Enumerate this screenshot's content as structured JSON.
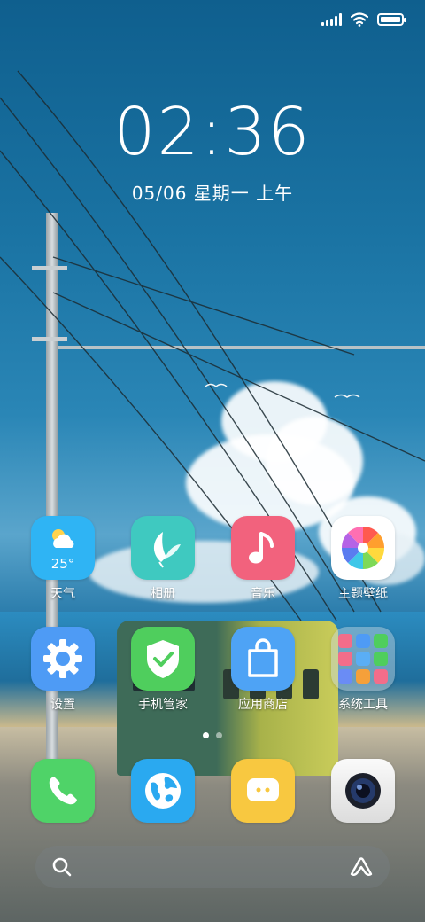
{
  "status_bar": {
    "signal": "signal-icon",
    "wifi": "wifi-icon",
    "battery": "battery-icon",
    "battery_level": 1.0
  },
  "lockscreen": {
    "time": "02:36",
    "date": "05/06 星期一 上午"
  },
  "apps_row1": [
    {
      "label": "天气",
      "icon": "weather-icon",
      "badge_text": "25°"
    },
    {
      "label": "相册",
      "icon": "gallery-icon"
    },
    {
      "label": "音乐",
      "icon": "music-icon"
    },
    {
      "label": "主题壁纸",
      "icon": "themes-icon"
    }
  ],
  "apps_row2": [
    {
      "label": "设置",
      "icon": "settings-icon"
    },
    {
      "label": "手机管家",
      "icon": "security-icon"
    },
    {
      "label": "应用商店",
      "icon": "app-store-icon"
    },
    {
      "label": "系统工具",
      "icon": "system-tools-folder-icon"
    }
  ],
  "dock": [
    {
      "icon": "phone-icon"
    },
    {
      "icon": "browser-icon"
    },
    {
      "icon": "messages-icon"
    },
    {
      "icon": "camera-icon"
    }
  ],
  "page_indicator": {
    "count": 2,
    "active": 0
  },
  "search": {
    "left_icon": "search-icon",
    "right_icon": "assistant-icon"
  },
  "colors": {
    "weather": "#2fb4f4",
    "gallery": "#3fc9c0",
    "music": "#f2627d",
    "themes": "#ffffff",
    "settings": "#4e9bf5",
    "security": "#4fce5d",
    "app_store": "#4ea3f5",
    "phone": "#4fd368",
    "browser": "#2aa9f0",
    "messages": "#f8c840",
    "camera": "#eeeeee"
  }
}
